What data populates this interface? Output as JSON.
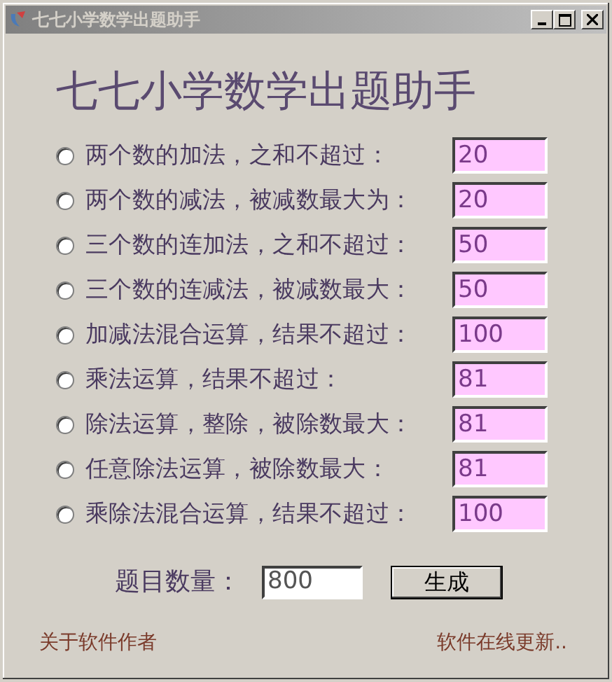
{
  "window": {
    "title": "七七小学数学出题助手"
  },
  "heading": "七七小学数学出题助手",
  "options": [
    {
      "label": "两个数的加法，之和不超过：",
      "value": "20",
      "selected": false
    },
    {
      "label": "两个数的减法，被减数最大为：",
      "value": "20",
      "selected": false
    },
    {
      "label": "三个数的连加法，之和不超过：",
      "value": "50",
      "selected": false
    },
    {
      "label": "三个数的连减法，被减数最大：",
      "value": "50",
      "selected": false
    },
    {
      "label": "加减法混合运算，结果不超过：",
      "value": "100",
      "selected": false
    },
    {
      "label": "乘法运算，结果不超过：",
      "value": "81",
      "selected": false
    },
    {
      "label": "除法运算，整除，被除数最大：",
      "value": "81",
      "selected": false
    },
    {
      "label": "任意除法运算，被除数最大：",
      "value": "81",
      "selected": false
    },
    {
      "label": "乘除法混合运算，结果不超过：",
      "value": "100",
      "selected": false
    }
  ],
  "count": {
    "label": "题目数量：",
    "value": "800"
  },
  "generate_button": "生成",
  "footer": {
    "about_link": "关于软件作者",
    "update_link": "软件在线更新.."
  }
}
